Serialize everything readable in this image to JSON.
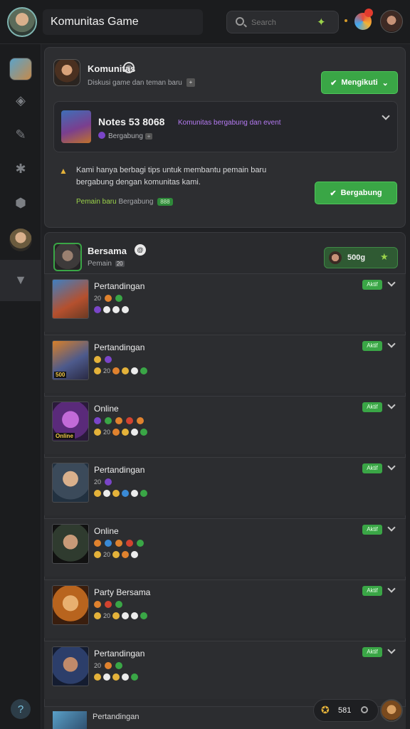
{
  "app": {
    "title": "Komunitas Game"
  },
  "search": {
    "placeholder": "Search"
  },
  "community": {
    "name": "Komunitas",
    "name_icon": "@",
    "subtitle": "Diskusi game dan teman baru",
    "subtitle_badge": "+",
    "follow_label": "Mengikuti",
    "join": {
      "title": "Notes 53 8068",
      "highlight": "Komunitas bergabung dan event",
      "subtitle": "Bergabung",
      "subtitle_badge": "+"
    },
    "notice": {
      "text": "Kami hanya berbagi tips untuk membantu pemain baru bergabung dengan komunitas kami.",
      "meta_green": "Pemain baru",
      "meta_text": "Bergabung",
      "meta_tag": "888"
    },
    "notice_button": "Bergabung"
  },
  "list": {
    "header": {
      "title": "Bersama",
      "title_icon": "@",
      "subtitle": "Pemain",
      "subtitle_tag": "20",
      "pill_label": "500g"
    },
    "rows": [
      {
        "title": "Pertandingan",
        "num": "20",
        "badge": "Aktif",
        "img_label": ""
      },
      {
        "title": "Pertandingan",
        "num": "20",
        "badge": "Aktif",
        "img_label": "500"
      },
      {
        "title": "Online",
        "num": "20",
        "badge": "Aktif",
        "img_label": "Online"
      },
      {
        "title": "Pertandingan",
        "num": "20",
        "badge": "Aktif",
        "img_label": ""
      },
      {
        "title": "Online",
        "num": "20",
        "badge": "Aktif",
        "img_label": ""
      },
      {
        "title": "Party Bersama",
        "num": "20",
        "badge": "Aktif",
        "img_label": ""
      },
      {
        "title": "Pertandingan",
        "num": "20",
        "badge": "Aktif",
        "img_label": ""
      }
    ],
    "bottom_row": "Pertandingan"
  },
  "floating": {
    "count": "581"
  },
  "icons": {
    "search": "search-icon",
    "check": "check-icon",
    "chevron": "chevron-down-icon",
    "warning": "warning-icon",
    "star": "star-icon"
  },
  "colors": {
    "accent": "#3aa646",
    "highlight": "#b57af2",
    "background": "#202124"
  }
}
